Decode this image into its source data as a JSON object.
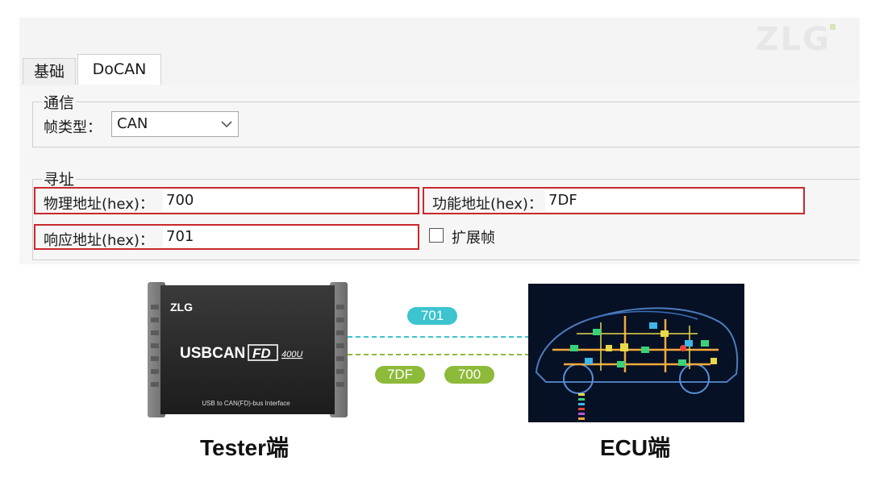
{
  "watermark": "ZLG",
  "tabs": [
    {
      "label": "基础"
    },
    {
      "label": "DoCAN"
    }
  ],
  "communication": {
    "group_title": "通信",
    "frame_type_label": "帧类型：",
    "frame_type_value": "CAN"
  },
  "addressing": {
    "group_title": "寻址",
    "physical_label": "物理地址(hex)：",
    "physical_value": "700",
    "functional_label": "功能地址(hex)：",
    "functional_value": "7DF",
    "response_label": "响应地址(hex)：",
    "response_value": "701",
    "extended_frame_label": "扩展帧",
    "extended_frame_checked": false
  },
  "diagram": {
    "device_brand": "ZLG",
    "device_model": "USBCAN",
    "device_model_box": "FD",
    "device_variant": "400U",
    "device_subtitle": "USB to CAN(FD)-bus Interface",
    "pill_response": "701",
    "pill_functional": "7DF",
    "pill_physical": "700",
    "tester_caption": "Tester端",
    "ecu_caption": "ECU端",
    "colors": {
      "response_line": "#3cc4cf",
      "request_line": "#8dba38",
      "highlight_red": "#c8292d"
    }
  }
}
